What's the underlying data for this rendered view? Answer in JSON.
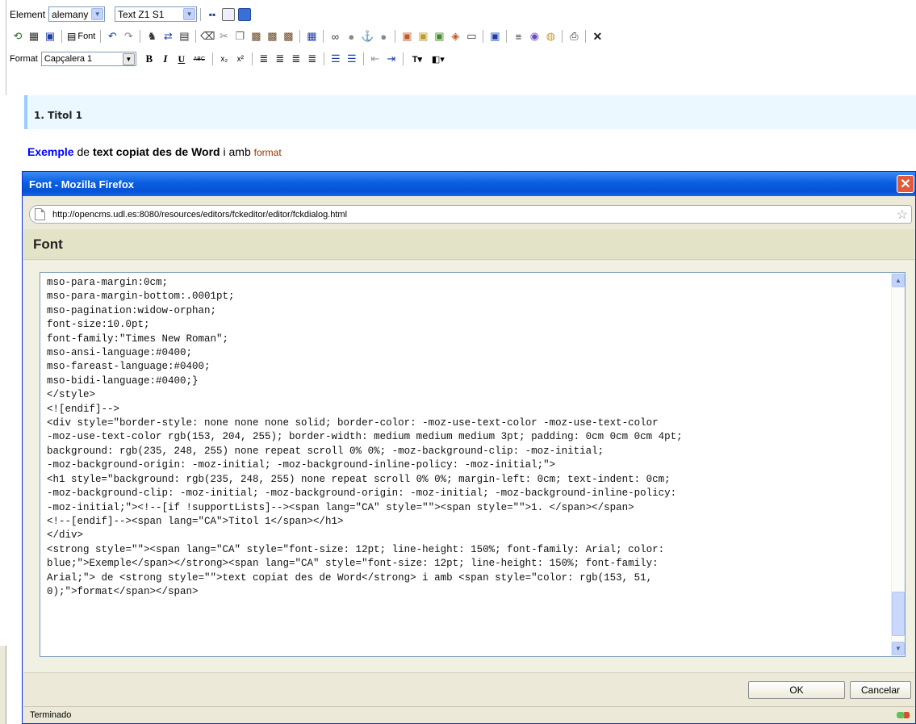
{
  "toolbar": {
    "element_label": "Element",
    "element_value": "alemany",
    "style_value": "Text Z1 S1",
    "font_button": "Font",
    "format_label": "Format",
    "format_value": "Capçalera 1",
    "row2_icons": [
      "source-icon",
      "template-icon",
      "save-icon",
      "font-icon",
      "undo-icon",
      "redo-icon",
      "find-icon",
      "replace-icon",
      "select-all-icon",
      "remove-format-icon",
      "cut-icon",
      "copy-icon",
      "paste-icon",
      "paste-text-icon",
      "paste-word-icon",
      "table-icon",
      "link-icon",
      "unlink-icon",
      "anchor-icon",
      "gallery-link-icon",
      "image-icon",
      "image-gallery-icon",
      "download-gallery-icon",
      "html-gallery-icon",
      "frame-icon",
      "flash-icon",
      "rule-icon",
      "special-char-icon",
      "smiley-icon",
      "print-icon",
      "close-icon"
    ],
    "bold": "B",
    "italic": "I",
    "underline": "U",
    "strike": "ABC",
    "subscript": "x₂",
    "superscript": "x²"
  },
  "document": {
    "heading": "1. Titol 1",
    "para_exemple": "Exemple",
    "para_de": " de ",
    "para_bold": "text copiat des de Word",
    "para_iamb": " i amb ",
    "para_format": "format"
  },
  "dialog": {
    "window_title": "Font - Mozilla Firefox",
    "url": "http://opencms.udl.es:8080/resources/editors/fckeditor/editor/fckdialog.html",
    "heading": "Font",
    "code": "mso-para-margin:0cm;\nmso-para-margin-bottom:.0001pt;\nmso-pagination:widow-orphan;\nfont-size:10.0pt;\nfont-family:\"Times New Roman\";\nmso-ansi-language:#0400;\nmso-fareast-language:#0400;\nmso-bidi-language:#0400;}\n</style>\n<![endif]-->\n<div style=\"border-style: none none none solid; border-color: -moz-use-text-color -moz-use-text-color\n-moz-use-text-color rgb(153, 204, 255); border-width: medium medium medium 3pt; padding: 0cm 0cm 0cm 4pt;\nbackground: rgb(235, 248, 255) none repeat scroll 0% 0%; -moz-background-clip: -moz-initial;\n-moz-background-origin: -moz-initial; -moz-background-inline-policy: -moz-initial;\">\n<h1 style=\"background: rgb(235, 248, 255) none repeat scroll 0% 0%; margin-left: 0cm; text-indent: 0cm;\n-moz-background-clip: -moz-initial; -moz-background-origin: -moz-initial; -moz-background-inline-policy:\n-moz-initial;\"><!--[if !supportLists]--><span lang=\"CA\" style=\"\"><span style=\"\">1. </span></span>\n<!--[endif]--><span lang=\"CA\">Titol 1</span></h1>\n</div>\n<strong style=\"\"><span lang=\"CA\" style=\"font-size: 12pt; line-height: 150%; font-family: Arial; color:\nblue;\">Exemple</span></strong><span lang=\"CA\" style=\"font-size: 12pt; line-height: 150%; font-family:\nArial;\"> de <strong style=\"\">text copiat des de Word</strong> i amb <span style=\"color: rgb(153, 51,\n0);\">format</span></span>",
    "ok_label": "OK",
    "cancel_label": "Cancelar",
    "status": "Terminado"
  },
  "colors": {
    "title_blue": "#0a5ee0",
    "heading_bg": "#ebf8ff",
    "heading_border": "#99ccff",
    "exemple": "#0000ff",
    "format_word": "#993300"
  }
}
